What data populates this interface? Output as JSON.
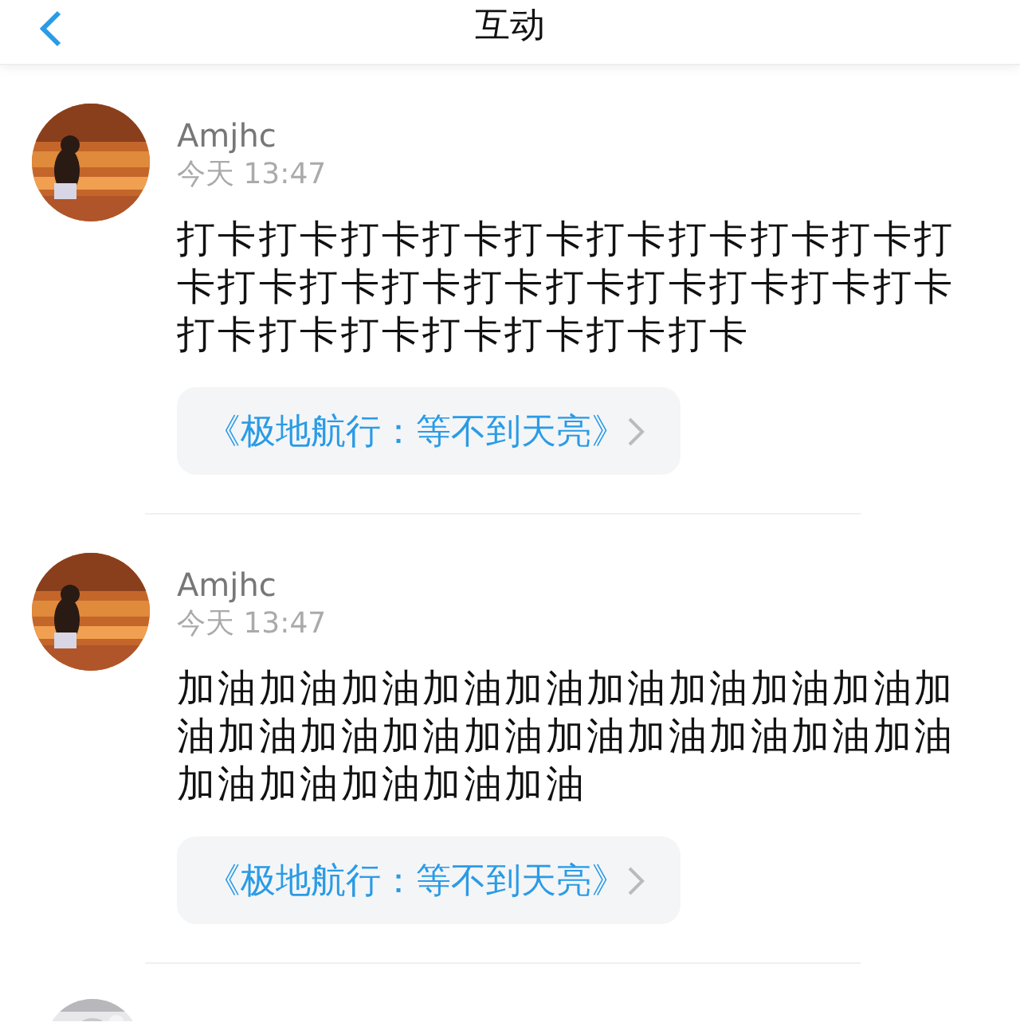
{
  "header": {
    "title": "互动"
  },
  "posts": [
    {
      "user": "Amjhc",
      "time": "今天 13:47",
      "text": "打卡打卡打卡打卡打卡打卡打卡打卡打卡打卡打卡打卡打卡打卡打卡打卡打卡打卡打卡打卡打卡打卡打卡打卡打卡打卡",
      "link": "《极地航行：等不到天亮》"
    },
    {
      "user": "Amjhc",
      "time": "今天 13:47",
      "text": "加油加油加油加油加油加油加油加油加油加油加油加油加油加油加油加油加油加油加油加油加油加油加油加油",
      "link": "《极地航行：等不到天亮》"
    }
  ]
}
